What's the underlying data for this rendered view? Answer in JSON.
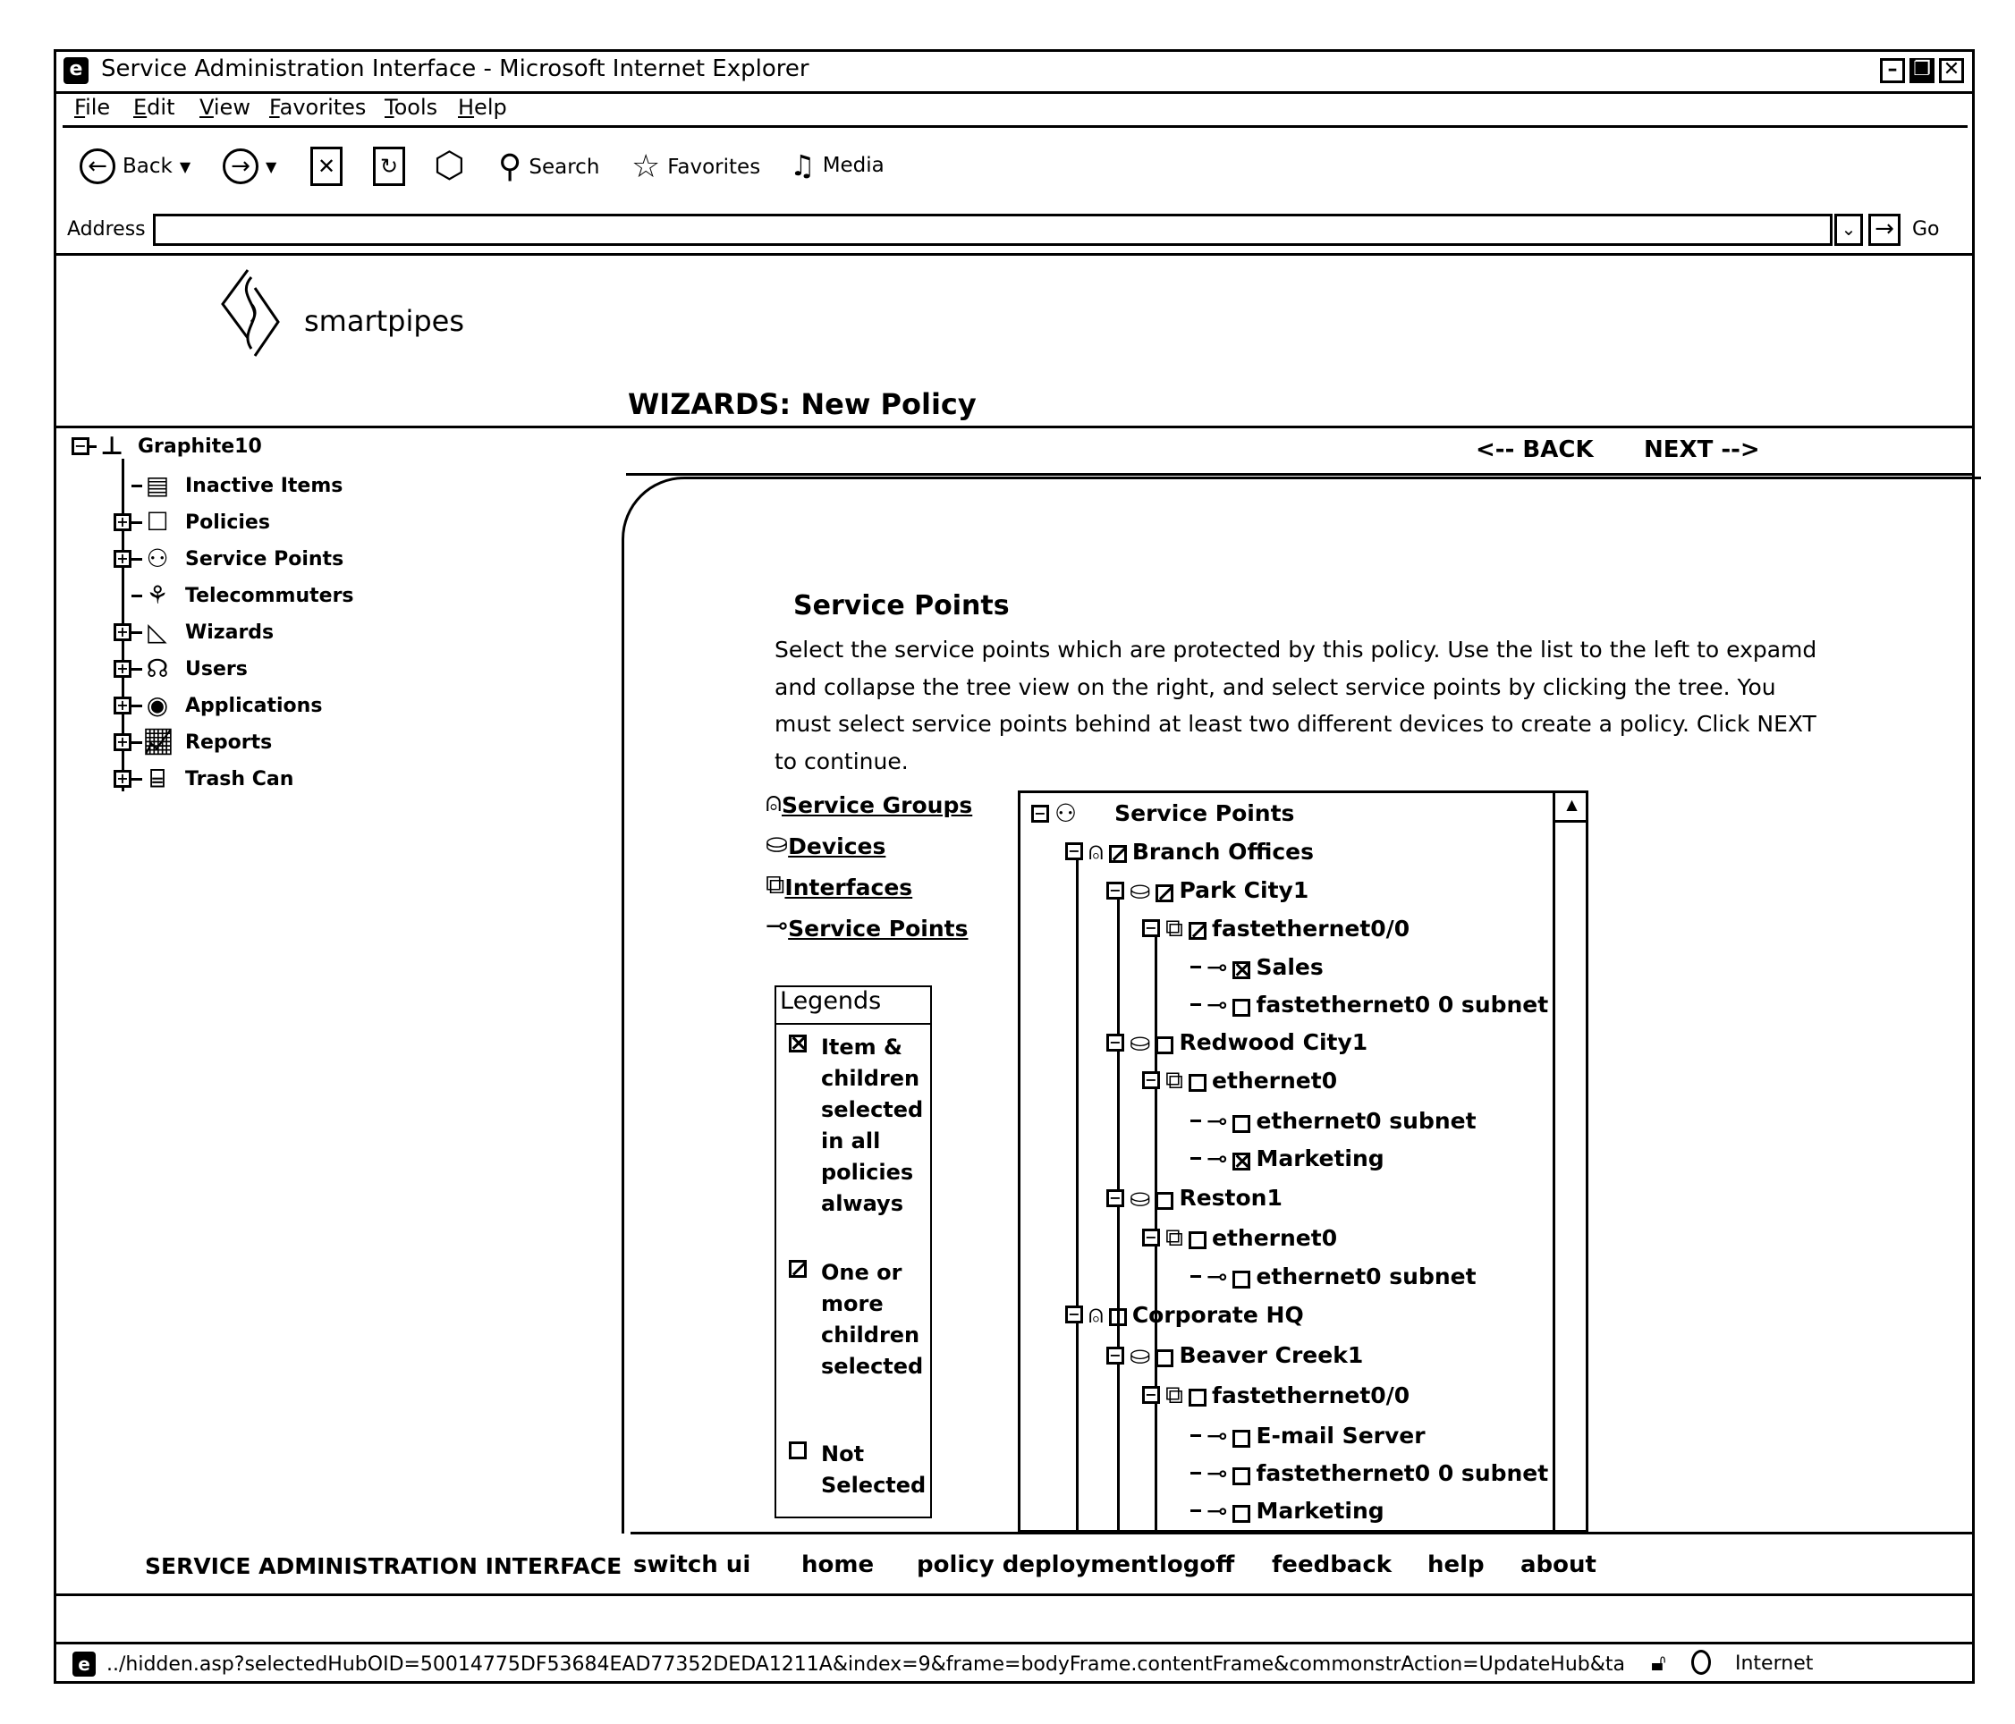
{
  "window": {
    "title": "Service Administration Interface - Microsoft Internet Explorer",
    "controls": [
      "minimize",
      "restore",
      "close"
    ]
  },
  "menu": [
    {
      "label": "File",
      "accel": "F",
      "rest": "ile"
    },
    {
      "label": "Edit",
      "accel": "E",
      "rest": "dit"
    },
    {
      "label": "View",
      "accel": "V",
      "rest": "iew"
    },
    {
      "label": "Favorites",
      "accel": "F",
      "rest": "avorites"
    },
    {
      "label": "Tools",
      "accel": "T",
      "rest": "ools"
    },
    {
      "label": "Help",
      "accel": "H",
      "rest": "elp"
    }
  ],
  "toolbar": {
    "back": "Back",
    "search": "Search",
    "favorites": "Favorites",
    "media": "Media",
    "icons": [
      "back-arrow-icon",
      "forward-arrow-icon",
      "stop-icon",
      "refresh-icon",
      "home-icon",
      "search-icon",
      "favorites-star-icon",
      "media-icon"
    ]
  },
  "address": {
    "label": "Address",
    "value": "",
    "go": "Go"
  },
  "brand": {
    "name": "smartpipes"
  },
  "page": {
    "title": "WIZARDS: New Policy",
    "nav_back": "<-- BACK",
    "nav_next": "NEXT -->"
  },
  "left_tree": {
    "root": "Graphite10",
    "items": [
      {
        "label": "Inactive Items",
        "expandable": false,
        "icon": "inactive-items-icon"
      },
      {
        "label": "Policies",
        "expandable": true,
        "icon": "policy-icon"
      },
      {
        "label": "Service Points",
        "expandable": true,
        "icon": "service-points-icon"
      },
      {
        "label": "Telecommuters",
        "expandable": false,
        "icon": "telecommuters-icon"
      },
      {
        "label": "Wizards",
        "expandable": true,
        "icon": "wizard-icon"
      },
      {
        "label": "Users",
        "expandable": true,
        "icon": "user-icon"
      },
      {
        "label": "Applications",
        "expandable": true,
        "icon": "application-icon"
      },
      {
        "label": "Reports",
        "expandable": true,
        "icon": "report-icon"
      },
      {
        "label": "Trash Can",
        "expandable": true,
        "icon": "trash-can-icon"
      }
    ]
  },
  "section": {
    "title": "Service Points",
    "description": "Select the service points which are protected by this policy. Use the list to the left to expamd and collapse the tree view on the right, and select service points by clicking the tree. You must select service points behind at least two different devices to create a policy. Click NEXT to continue."
  },
  "quick_links": [
    {
      "label": "Service Groups",
      "icon": "service-group-icon"
    },
    {
      "label": "Devices",
      "icon": "device-icon"
    },
    {
      "label": "Interfaces",
      "icon": "interface-icon"
    },
    {
      "label": "Service Points",
      "icon": "service-point-key-icon"
    }
  ],
  "legend": {
    "title": "Legends",
    "items": [
      {
        "state": "full",
        "text": "Item & children selected in all policies always"
      },
      {
        "state": "partial",
        "text": "One or more children selected"
      },
      {
        "state": "none",
        "text": "Not Selected"
      }
    ]
  },
  "service_tree": {
    "root": "Service Points",
    "nodes": [
      {
        "level": 1,
        "type": "group",
        "label": "Branch Offices",
        "state": "partial"
      },
      {
        "level": 2,
        "type": "device",
        "label": "Park City1",
        "state": "partial"
      },
      {
        "level": 3,
        "type": "interface",
        "label": "fastethernet0/0",
        "state": "partial"
      },
      {
        "level": 4,
        "type": "point",
        "label": "Sales",
        "state": "full"
      },
      {
        "level": 4,
        "type": "point",
        "label": "fastethernet0 0 subnet",
        "state": "none"
      },
      {
        "level": 2,
        "type": "device",
        "label": "Redwood City1",
        "state": "none"
      },
      {
        "level": 3,
        "type": "interface",
        "label": "ethernet0",
        "state": "none"
      },
      {
        "level": 4,
        "type": "point",
        "label": "ethernet0 subnet",
        "state": "none"
      },
      {
        "level": 4,
        "type": "point",
        "label": "Marketing",
        "state": "full"
      },
      {
        "level": 2,
        "type": "device",
        "label": "Reston1",
        "state": "none"
      },
      {
        "level": 3,
        "type": "interface",
        "label": "ethernet0",
        "state": "none"
      },
      {
        "level": 4,
        "type": "point",
        "label": "ethernet0 subnet",
        "state": "none"
      },
      {
        "level": 1,
        "type": "group",
        "label": "Corporate HQ",
        "state": "none"
      },
      {
        "level": 2,
        "type": "device",
        "label": "Beaver Creek1",
        "state": "none"
      },
      {
        "level": 3,
        "type": "interface",
        "label": "fastethernet0/0",
        "state": "none"
      },
      {
        "level": 4,
        "type": "point",
        "label": "E-mail Server",
        "state": "none"
      },
      {
        "level": 4,
        "type": "point",
        "label": "fastethernet0 0 subnet",
        "state": "none"
      },
      {
        "level": 4,
        "type": "point",
        "label": "Marketing",
        "state": "none"
      }
    ]
  },
  "footer": {
    "label": "SERVICE ADMINISTRATION INTERFACE",
    "links": [
      "switch ui",
      "home",
      "policy deployment",
      "logoff",
      "feedback",
      "help",
      "about"
    ]
  },
  "status": {
    "url": "../hidden.asp?selectedHubOID=50014775DF53684EAD77352DEDA1211A&index=9&frame=bodyFrame.contentFrame&commonstrAction=UpdateHub&ta",
    "zone": "Internet"
  }
}
